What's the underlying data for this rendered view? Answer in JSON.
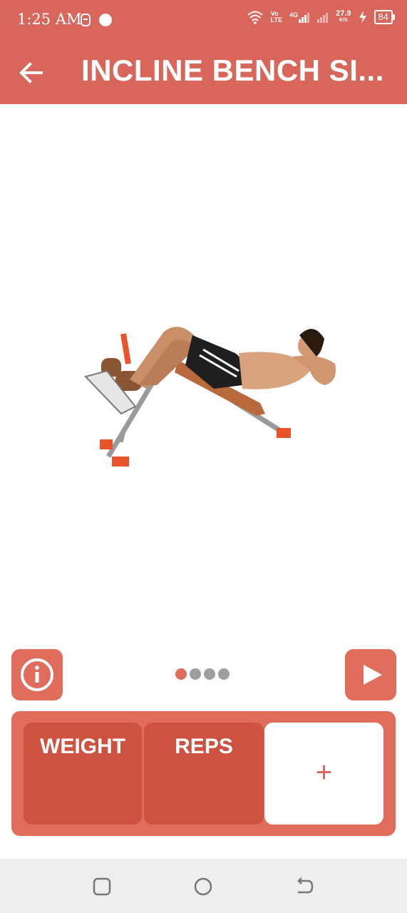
{
  "status_bar": {
    "time": "1:25 AM",
    "network_speed": "27.9",
    "network_speed_unit": "K/S",
    "network_type": "4G",
    "volte": "Vo",
    "volte_sub": "LTE",
    "battery": "84"
  },
  "header": {
    "title": "INCLINE BENCH SI..."
  },
  "pager": {
    "dots": 4,
    "active": 0
  },
  "panel": {
    "weight_label": "WEIGHT",
    "reps_label": "REPS",
    "add_label": "+"
  },
  "colors": {
    "header": "#d9665a",
    "accent": "#e06c5b",
    "cell": "#cd5340"
  },
  "icons": {
    "back": "arrow-left-icon",
    "info": "info-icon",
    "play": "play-icon",
    "nav_recent": "square-icon",
    "nav_home": "circle-icon",
    "nav_back": "back-arrow-icon"
  }
}
